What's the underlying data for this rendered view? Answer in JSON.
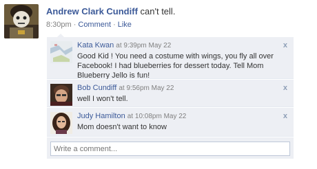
{
  "post": {
    "author": "Andrew Clark Cundiff",
    "status": "can't tell.",
    "time": "8:30pm",
    "comment_label": "Comment",
    "like_label": "Like",
    "separator": "·"
  },
  "comments": [
    {
      "author": "Kata Kwan",
      "time": "at 9:39pm May 22",
      "text": "Good Kid ! You need a costume with wings, you fly all over Facebook! I had blueberries for dessert today. Tell Mom Blueberry Jello is fun!",
      "remove": "x"
    },
    {
      "author": "Bob Cundiff",
      "time": "at 9:56pm May 22",
      "text": "well I won't tell.",
      "remove": "x"
    },
    {
      "author": "Judy Hamilton",
      "time": "at 10:08pm May 22",
      "text": "Mom doesn't want to know",
      "remove": "x"
    }
  ],
  "write_comment": {
    "placeholder": "Write a comment..."
  },
  "colors": {
    "link": "#3b5998",
    "comment_bg": "#edeff4",
    "meta": "#808080"
  }
}
